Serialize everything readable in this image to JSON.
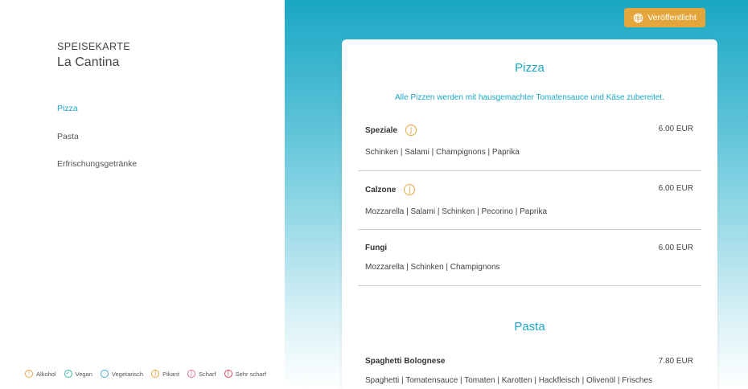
{
  "sidebar": {
    "eyebrow": "SPEISEKARTE",
    "restaurant": "La Cantina",
    "categories": [
      "Pizza",
      "Pasta",
      "Erfrischungsgetränke"
    ],
    "active_category": "Pizza"
  },
  "legend": [
    {
      "label": "Alkohol",
      "icon": "alcohol-icon",
      "color": "#e4a53a"
    },
    {
      "label": "Vegan",
      "icon": "vegan-icon",
      "color": "#3ab7a9"
    },
    {
      "label": "Vegetarisch",
      "icon": "vegetarian-icon",
      "color": "#4aa8d8"
    },
    {
      "label": "Pikant",
      "icon": "pikant-icon",
      "color": "#e4a53a"
    },
    {
      "label": "Scharf",
      "icon": "scharf-icon",
      "color": "#e26a8a"
    },
    {
      "label": "Sehr scharf",
      "icon": "sehr-scharf-icon",
      "color": "#d9415d"
    }
  ],
  "toolbar": {
    "publish_label": "Veröffentlicht",
    "publish_icon": "globe-icon"
  },
  "colors": {
    "accent": "#1aa7c4",
    "publish": "#e4a53a"
  },
  "menu": {
    "pizza": {
      "title": "Pizza",
      "note": "Alle Pizzen werden mit hausgemachter Tomatensauce und Käse zubereitet.",
      "dishes": [
        {
          "name": "Speziale",
          "price": "6.00 EUR",
          "ingredients": "Schinken | Salami | Champignons | Paprika",
          "pikant": true
        },
        {
          "name": "Calzone",
          "price": "6.00 EUR",
          "ingredients": "Mozzarella | Salami | Schinken | Pecorino | Paprika",
          "pikant": true
        },
        {
          "name": "Fungi",
          "price": "6.00 EUR",
          "ingredients": "Mozzarella | Schinken | Champignons",
          "pikant": false
        }
      ]
    },
    "pasta": {
      "title": "Pasta",
      "dishes": [
        {
          "name": "Spaghetti Bolognese",
          "price": "7.80 EUR",
          "ingredients": "Spaghetti | Tomatensauce | Tomaten | Karotten | Hackfleisch | Olivenöl | Frisches"
        }
      ]
    }
  }
}
